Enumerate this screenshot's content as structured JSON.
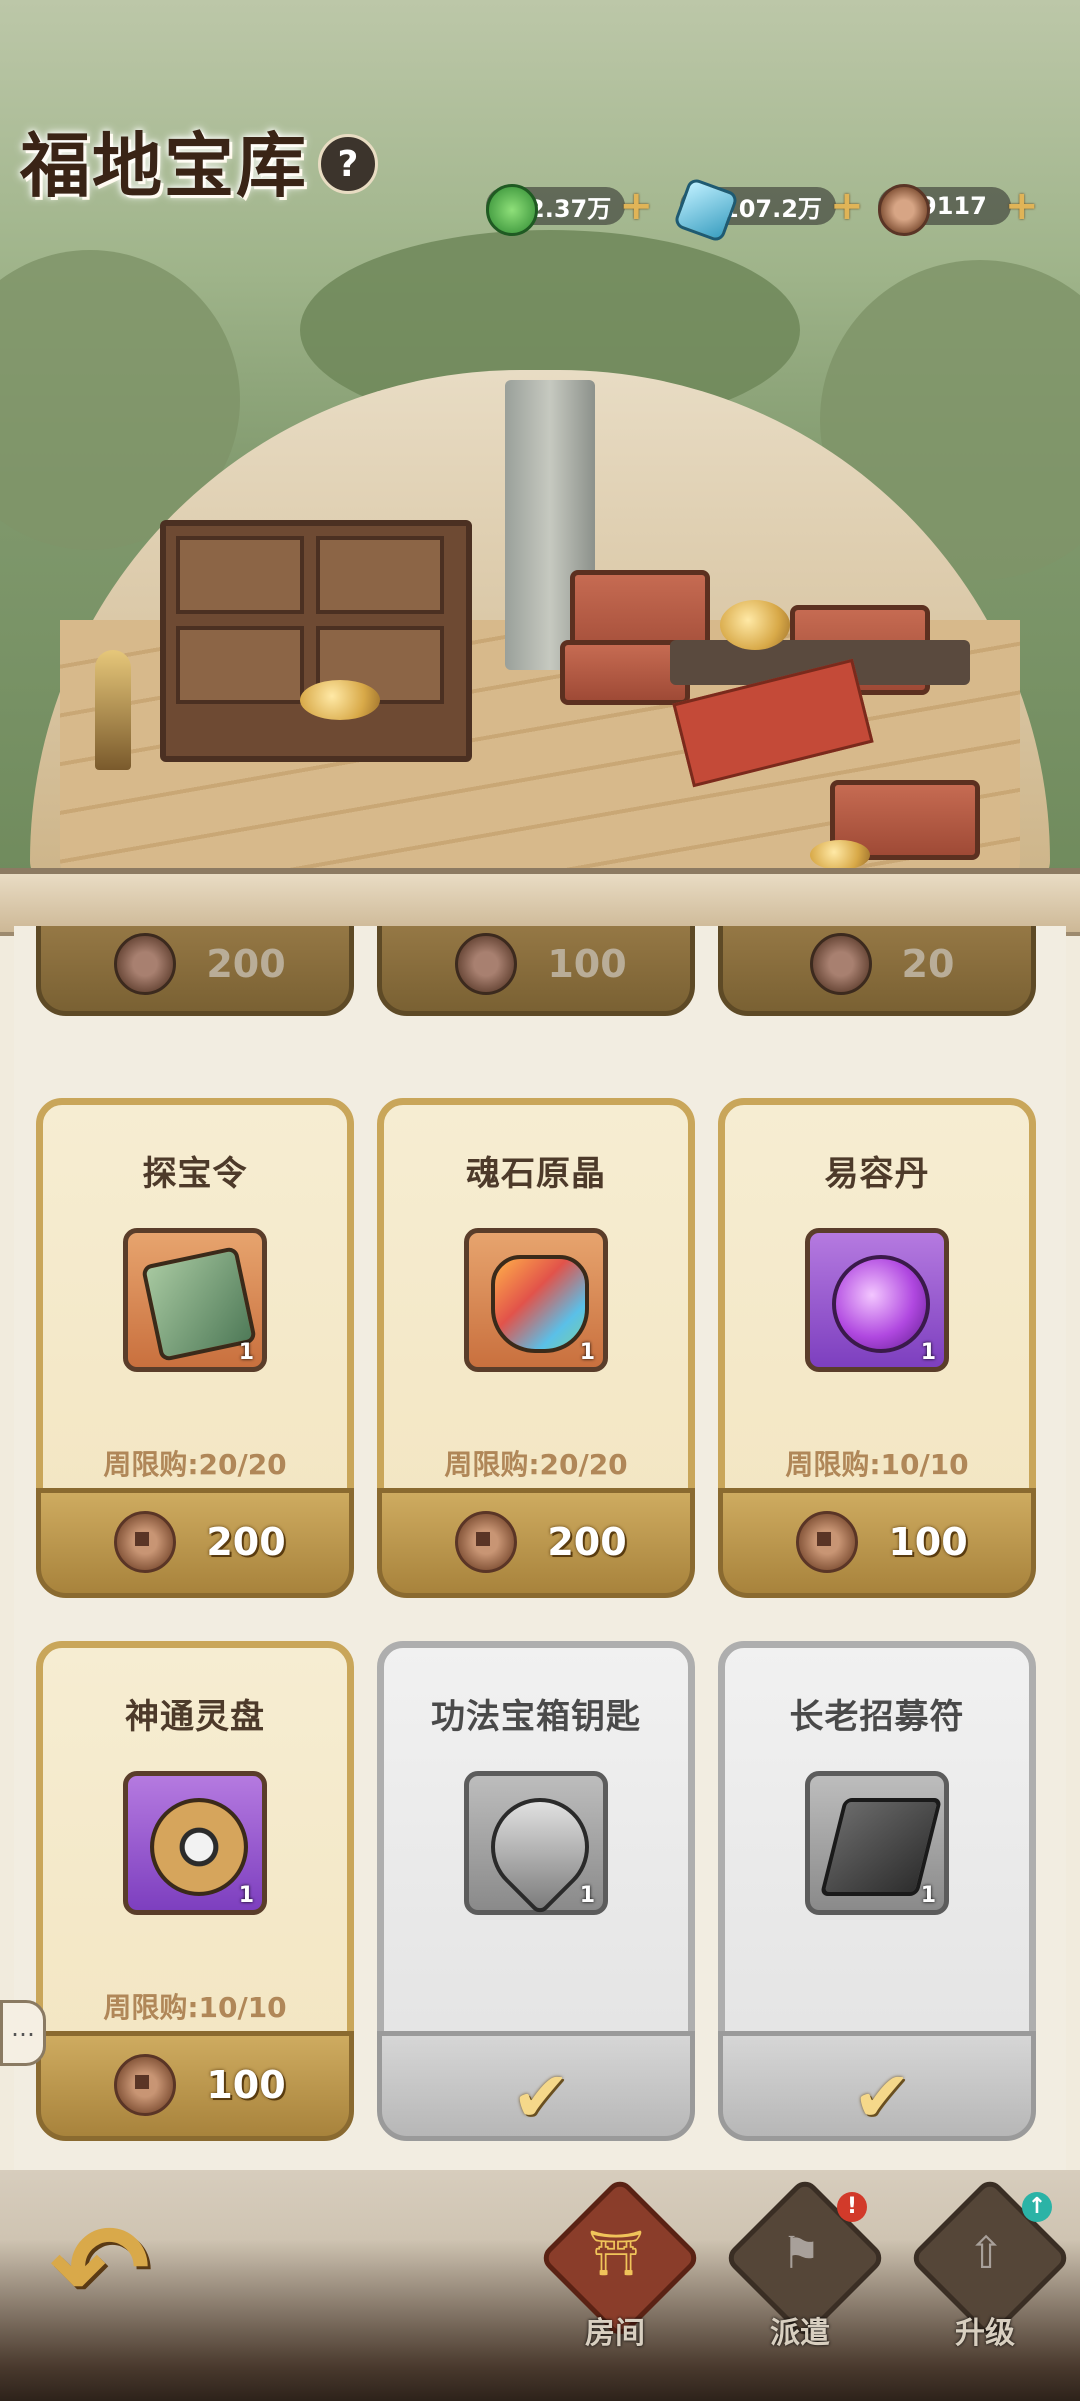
{
  "header": {
    "title": "福地宝库",
    "help_label": "?"
  },
  "resources": [
    {
      "name": "spirit-jade",
      "value": "2.37万",
      "color": "#4ca94a"
    },
    {
      "name": "spirit-crystal",
      "value": "107.2万",
      "color": "#5fb5d6"
    },
    {
      "name": "copper-coin",
      "value": "9117",
      "color": "#b07a58"
    }
  ],
  "shop": {
    "previous_row_prices": [
      "200",
      "100",
      "20"
    ],
    "items": [
      {
        "name": "探宝令",
        "qty": "1",
        "limit": "周限购:20/20",
        "price": "200",
        "sold_out": false,
        "icon": "treasure-token-icon",
        "icon_bg": "#d98a5a"
      },
      {
        "name": "魂石原晶",
        "qty": "1",
        "limit": "周限购:20/20",
        "price": "200",
        "sold_out": false,
        "icon": "soul-crystal-icon",
        "icon_bg": "#d98a5a"
      },
      {
        "name": "易容丹",
        "qty": "1",
        "limit": "周限购:10/10",
        "price": "100",
        "sold_out": false,
        "icon": "disguise-pill-icon",
        "icon_bg": "#9a5fcf"
      },
      {
        "name": "神通灵盘",
        "qty": "1",
        "limit": "周限购:10/10",
        "price": "100",
        "sold_out": false,
        "icon": "divine-disc-icon",
        "icon_bg": "#9a5fcf"
      },
      {
        "name": "功法宝箱钥匙",
        "qty": "1",
        "limit": "",
        "price": "",
        "sold_out": true,
        "icon": "key-icon",
        "icon_bg": "#9a9a9a"
      },
      {
        "name": "长老招募符",
        "qty": "1",
        "limit": "",
        "price": "",
        "sold_out": true,
        "icon": "talisman-icon",
        "icon_bg": "#9a9a9a"
      }
    ],
    "check_mark": "✔"
  },
  "nav": {
    "back_glyph": "↶",
    "tabs": [
      {
        "label": "房间",
        "active": true,
        "icon": "room-icon"
      },
      {
        "label": "派遣",
        "active": false,
        "icon": "dispatch-flag-icon",
        "badge": "!"
      },
      {
        "label": "升级",
        "active": false,
        "icon": "upgrade-icon",
        "badge": "↑"
      }
    ]
  },
  "side": {
    "chat_glyph": "…"
  }
}
